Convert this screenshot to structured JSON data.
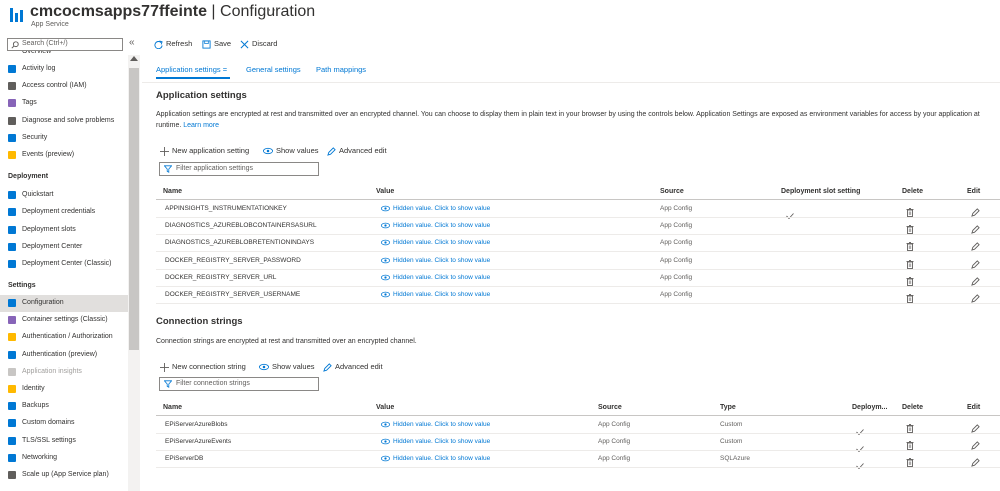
{
  "header": {
    "resource_name": "cmcocmsapps77ffeinte",
    "separator": " | ",
    "page": "Configuration",
    "subtitle": "App Service",
    "more": "···"
  },
  "sidebar": {
    "search_placeholder": "Search (Ctrl+/)",
    "collapse": "«",
    "partial_top": "Overview",
    "items_top": [
      {
        "label": "Activity log",
        "icon": "activity-log-icon",
        "color": "#0078d4"
      },
      {
        "label": "Access control (IAM)",
        "icon": "iam-icon",
        "color": "#605e5c"
      },
      {
        "label": "Tags",
        "icon": "tag-icon",
        "color": "#8764b8"
      },
      {
        "label": "Diagnose and solve problems",
        "icon": "wrench-icon",
        "color": "#605e5c"
      },
      {
        "label": "Security",
        "icon": "shield-icon",
        "color": "#0078d4"
      },
      {
        "label": "Events (preview)",
        "icon": "lightning-icon",
        "color": "#ffb900"
      }
    ],
    "section_deployment": "Deployment",
    "items_deployment": [
      {
        "label": "Quickstart",
        "icon": "quickstart-icon",
        "color": "#0078d4"
      },
      {
        "label": "Deployment credentials",
        "icon": "credentials-icon",
        "color": "#0078d4"
      },
      {
        "label": "Deployment slots",
        "icon": "slots-icon",
        "color": "#0078d4"
      },
      {
        "label": "Deployment Center",
        "icon": "cube-icon",
        "color": "#0078d4"
      },
      {
        "label": "Deployment Center (Classic)",
        "icon": "cube-icon",
        "color": "#0078d4"
      }
    ],
    "section_settings": "Settings",
    "items_settings": [
      {
        "label": "Configuration",
        "icon": "config-bars-icon",
        "color": "#0078d4",
        "active": true
      },
      {
        "label": "Container settings (Classic)",
        "icon": "container-icon",
        "color": "#8764b8"
      },
      {
        "label": "Authentication / Authorization",
        "icon": "key-icon",
        "color": "#ffb900"
      },
      {
        "label": "Authentication (preview)",
        "icon": "user-icon",
        "color": "#0078d4"
      },
      {
        "label": "Application insights",
        "icon": "bulb-icon",
        "color": "#c8c6c4",
        "dim": true
      },
      {
        "label": "Identity",
        "icon": "identity-icon",
        "color": "#ffb900"
      },
      {
        "label": "Backups",
        "icon": "backup-icon",
        "color": "#0078d4"
      },
      {
        "label": "Custom domains",
        "icon": "domain-icon",
        "color": "#0078d4"
      },
      {
        "label": "TLS/SSL settings",
        "icon": "shield-icon",
        "color": "#0078d4"
      },
      {
        "label": "Networking",
        "icon": "network-icon",
        "color": "#0078d4"
      },
      {
        "label": "Scale up (App Service plan)",
        "icon": "scale-up-icon",
        "color": "#605e5c"
      }
    ]
  },
  "toolbar": {
    "refresh": "Refresh",
    "save": "Save",
    "discard": "Discard"
  },
  "tabs": [
    {
      "label": "Application settings",
      "active": true
    },
    {
      "label": "General settings"
    },
    {
      "label": "Path mappings"
    }
  ],
  "app_settings": {
    "title": "Application settings",
    "description": "Application settings are encrypted at rest and transmitted over an encrypted channel. You can choose to display them in plain text in your browser by using the controls below. Application Settings are exposed as environment variables for access by your application at runtime.",
    "learn_more": "Learn more",
    "new_button": "New application setting",
    "show_values": "Show values",
    "advanced_edit": "Advanced edit",
    "filter_placeholder": "Filter application settings",
    "columns": [
      "Name",
      "Value",
      "Source",
      "Deployment slot setting",
      "Delete",
      "Edit"
    ],
    "rows": [
      {
        "name": "APPINSIGHTS_INSTRUMENTATIONKEY",
        "value": "Hidden value. Click to show value",
        "source": "App Config",
        "slot": true
      },
      {
        "name": "DIAGNOSTICS_AZUREBLOBCONTAINERSASURL",
        "value": "Hidden value. Click to show value",
        "source": "App Config",
        "slot": false
      },
      {
        "name": "DIAGNOSTICS_AZUREBLOBRETENTIONINDAYS",
        "value": "Hidden value. Click to show value",
        "source": "App Config",
        "slot": false
      },
      {
        "name": "DOCKER_REGISTRY_SERVER_PASSWORD",
        "value": "Hidden value. Click to show value",
        "source": "App Config",
        "slot": false
      },
      {
        "name": "DOCKER_REGISTRY_SERVER_URL",
        "value": "Hidden value. Click to show value",
        "source": "App Config",
        "slot": false
      },
      {
        "name": "DOCKER_REGISTRY_SERVER_USERNAME",
        "value": "Hidden value. Click to show value",
        "source": "App Config",
        "slot": false
      }
    ]
  },
  "conn_strings": {
    "title": "Connection strings",
    "description": "Connection strings are encrypted at rest and transmitted over an encrypted channel.",
    "new_button": "New connection string",
    "show_values": "Show values",
    "advanced_edit": "Advanced edit",
    "filter_placeholder": "Filter connection strings",
    "columns": [
      "Name",
      "Value",
      "Source",
      "Type",
      "Deploym...",
      "Delete",
      "Edit"
    ],
    "rows": [
      {
        "name": "EPiServerAzureBlobs",
        "value": "Hidden value. Click to show value",
        "source": "App Config",
        "type": "Custom",
        "slot": true
      },
      {
        "name": "EPiServerAzureEvents",
        "value": "Hidden value. Click to show value",
        "source": "App Config",
        "type": "Custom",
        "slot": true
      },
      {
        "name": "EPiServerDB",
        "value": "Hidden value. Click to show value",
        "source": "App Config",
        "type": "SQLAzure",
        "slot": true
      }
    ]
  },
  "colors": {
    "accent": "#0078d4",
    "text": "#323130",
    "active_nav": "#e1dfdd"
  }
}
